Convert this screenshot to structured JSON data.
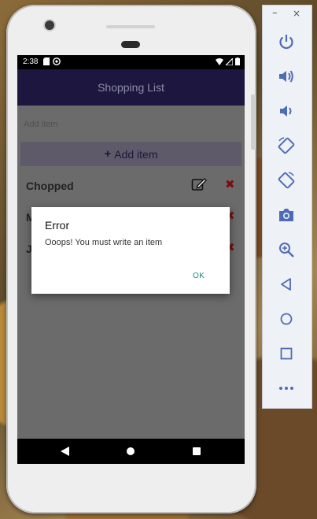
{
  "status_bar": {
    "time": "2:38"
  },
  "app_bar": {
    "title": "Shopping List"
  },
  "add_item": {
    "placeholder": "Add item",
    "button_label": "Add item",
    "button_plus": "+"
  },
  "list": {
    "items": [
      {
        "label": "Chopped"
      },
      {
        "label": "M"
      },
      {
        "label": "J"
      }
    ]
  },
  "dialog": {
    "title": "Error",
    "message": "Ooops! You must write an item",
    "ok_label": "OK"
  },
  "emulator": {
    "minimize": "–",
    "close": "×",
    "buttons": [
      {
        "icon": "power-icon"
      },
      {
        "icon": "volume-up-icon"
      },
      {
        "icon": "volume-down-icon"
      },
      {
        "icon": "rotate-left-icon"
      },
      {
        "icon": "rotate-right-icon"
      },
      {
        "icon": "camera-icon"
      },
      {
        "icon": "zoom-icon"
      },
      {
        "icon": "back-icon"
      },
      {
        "icon": "home-icon"
      },
      {
        "icon": "overview-icon"
      },
      {
        "icon": "more-icon"
      }
    ]
  },
  "colors": {
    "app_bar": "#1d163f",
    "delete": "#7a0e0e",
    "dialog_ok": "#148a7b",
    "emulator_icon": "#4e6cb5"
  }
}
